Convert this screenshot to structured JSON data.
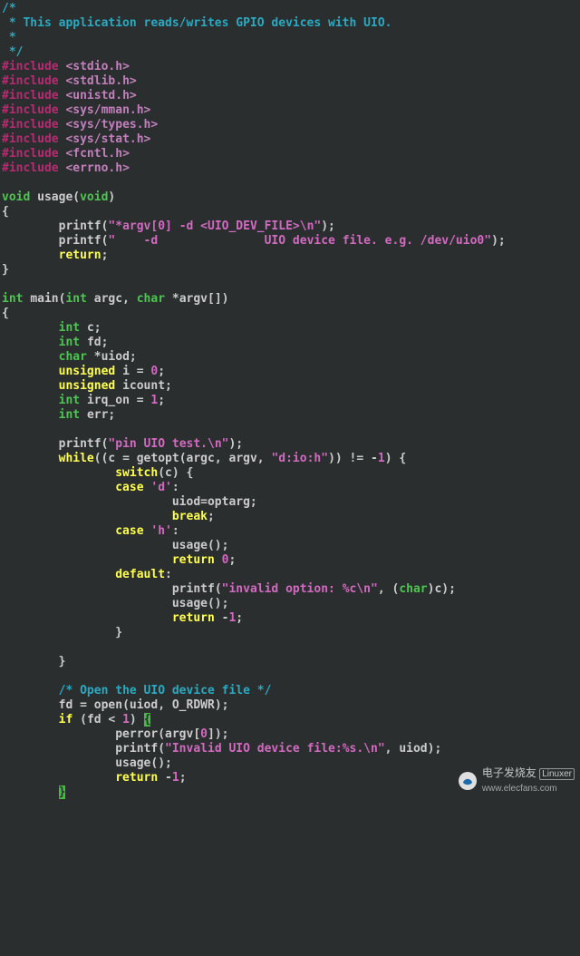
{
  "code": {
    "comment_top1": "/*",
    "comment_top2": " * This application reads/writes GPIO devices with UIO.",
    "comment_top3": " *",
    "comment_top4": " */",
    "inc": "#include",
    "h1": "<stdio.h>",
    "h2": "<stdlib.h>",
    "h3": "<unistd.h>",
    "h4": "<sys/mman.h>",
    "h5": "<sys/types.h>",
    "h6": "<sys/stat.h>",
    "h7": "<fcntl.h>",
    "h8": "<errno.h>",
    "void": "void",
    "usage": "usage",
    "lp": "(",
    "rp": ")",
    "lb": "{",
    "rb": "}",
    "printf": "printf",
    "s_usage1": "\"*argv[0] -d <UIO_DEV_FILE>\\n\"",
    "s_usage2": "\"    -d               UIO device file. e.g. /dev/uio0\"",
    "return": "return",
    "int": "int",
    "main": "main",
    "argc": "argc",
    "char": "char",
    "argv": "*argv[]",
    "decl_c": "c",
    "decl_fd": "fd",
    "uiod": "*uiod",
    "unsigned": "unsigned",
    "i": "i",
    "eq0": " = ",
    "zero": "0",
    "icount": "icount",
    "irq_on": "irq_on",
    "one": "1",
    "err": "err",
    "s_pintest": "\"pin UIO test.\\n\"",
    "while": "while",
    "getopt": "getopt",
    "s_optstr": "\"d:io:h\"",
    "neg1": "-",
    "one2": "1",
    "switch": "switch",
    "case": "case",
    "chr_d": "'d'",
    "uiod_assign": "uiod=optarg;",
    "break": "break",
    "chr_h": "'h'",
    "usage_call": "usage();",
    "return0": "return",
    "default": "default",
    "s_invalid": "\"invalid option: %c\\n\"",
    "castchar": "char",
    "c_var": "c",
    "rneg1": "return",
    "cmt_open": "/* Open the UIO device file */",
    "open": "open",
    "uiod2": "uiod",
    "O_RDWR": "O_RDWR",
    "if": "if",
    "fd2": "fd",
    "lt": "<",
    "perror": "perror",
    "argv0": "argv[",
    "zero2": "0",
    "s_invfile": "\"Invalid UIO device file:%s.\\n\"",
    "semicolon": ";",
    "comma": ", ",
    "colon": ":",
    "star": "*"
  },
  "watermark": {
    "brand": "电子发烧友",
    "sub": "Linuxer",
    "url": "www.elecfans.com"
  }
}
